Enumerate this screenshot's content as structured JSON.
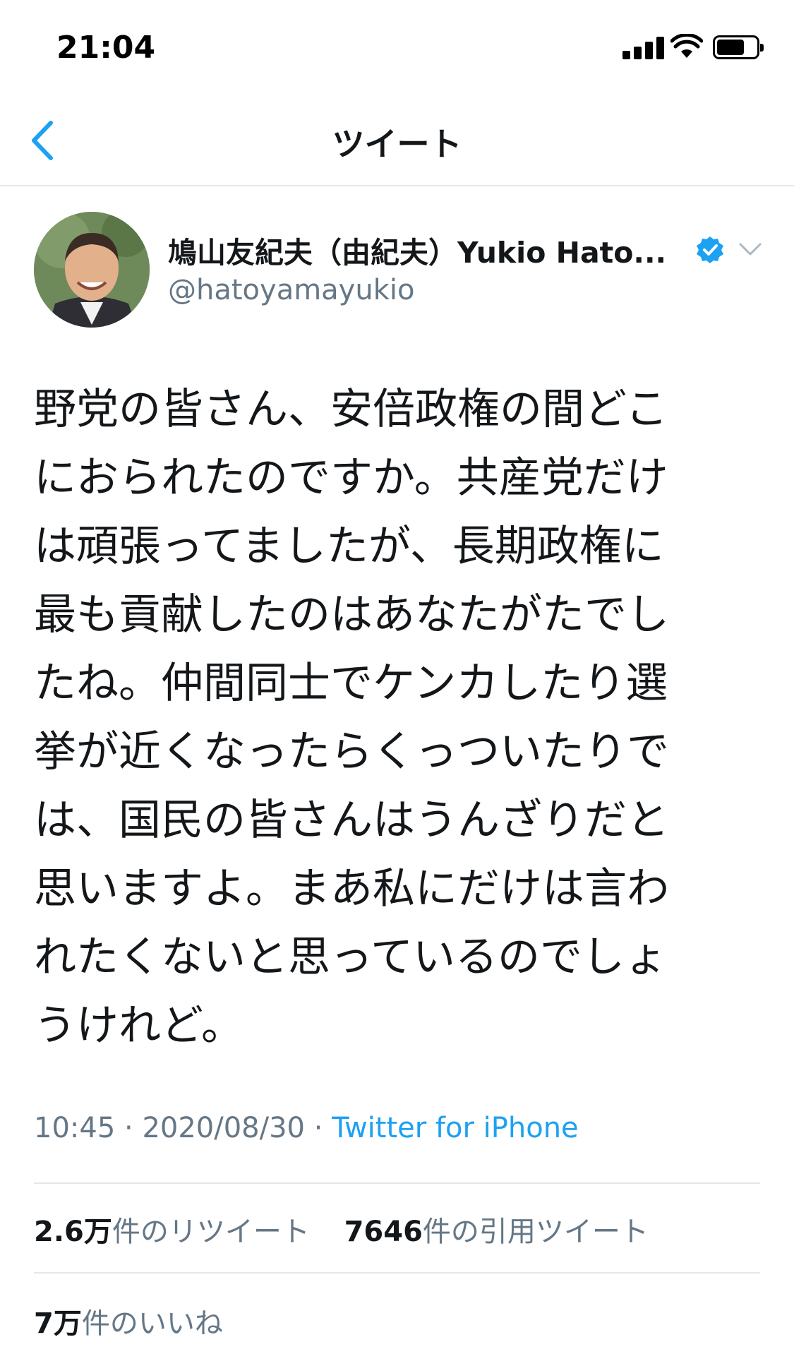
{
  "status_bar": {
    "time": "21:04"
  },
  "nav": {
    "title": "ツイート"
  },
  "tweet": {
    "author": {
      "display_name": "鳩山友紀夫（由紀夫）Yukio Hato...",
      "handle": "@hatoyamayukio",
      "verified": true
    },
    "text": "野党の皆さん、安倍政権の間どこ\nにおられたのですか。共産党だけ\nは頑張ってましたが、長期政権に\n最も貢献したのはあなたがたでし\nたね。仲間同士でケンカしたり選\n挙が近くなったらくっついたりで\nは、国民の皆さんはうんざりだと\n思いますよ。まあ私にだけは言わ\nれたくないと思っているのでしょ\nうけれど。",
    "time": "10:45",
    "date": "2020/08/30",
    "separator": "·",
    "source": "Twitter for iPhone",
    "stats": {
      "retweets_count": "2.6万",
      "retweets_label": "件のリツイート",
      "quotes_count": "7646",
      "quotes_label": "件の引用ツイート",
      "likes_count": "7万",
      "likes_label": "件のいいね"
    }
  },
  "colors": {
    "accent": "#1da1f2",
    "text_primary": "#14171a",
    "text_secondary": "#657786",
    "divider": "#e1e8ed",
    "verified": "#1da1f2"
  },
  "icons": {
    "back": "chevron-left-icon",
    "verified": "verified-badge-icon",
    "menu": "chevron-down-icon",
    "signal": "cellular-signal-icon",
    "wifi": "wifi-icon",
    "battery": "battery-icon"
  }
}
